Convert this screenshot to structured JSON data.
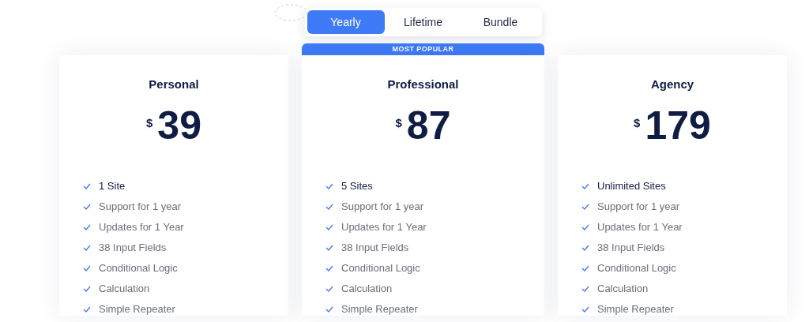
{
  "tabs": [
    {
      "label": "Yearly",
      "selected": true
    },
    {
      "label": "Lifetime",
      "selected": false
    },
    {
      "label": "Bundle",
      "selected": false
    }
  ],
  "plans": [
    {
      "name": "Personal",
      "currency": "$",
      "price": "39",
      "features": [
        {
          "text": "1 Site",
          "emphasis": true
        },
        {
          "text": "Support for 1 year",
          "emphasis": false
        },
        {
          "text": "Updates for 1 Year",
          "emphasis": false
        },
        {
          "text": "38 Input Fields",
          "emphasis": false
        },
        {
          "text": "Conditional Logic",
          "emphasis": false
        },
        {
          "text": "Calculation",
          "emphasis": false
        },
        {
          "text": "Simple Repeater",
          "emphasis": false
        }
      ]
    },
    {
      "name": "Professional",
      "currency": "$",
      "price": "87",
      "badge": "MOST POPULAR",
      "features": [
        {
          "text": "5 Sites",
          "emphasis": true
        },
        {
          "text": "Support for 1 year",
          "emphasis": false
        },
        {
          "text": "Updates for 1 Year",
          "emphasis": false
        },
        {
          "text": "38 Input Fields",
          "emphasis": false
        },
        {
          "text": "Conditional Logic",
          "emphasis": false
        },
        {
          "text": "Calculation",
          "emphasis": false
        },
        {
          "text": "Simple Repeater",
          "emphasis": false
        }
      ]
    },
    {
      "name": "Agency",
      "currency": "$",
      "price": "179",
      "features": [
        {
          "text": "Unlimited Sites",
          "emphasis": true
        },
        {
          "text": "Support for 1 year",
          "emphasis": false
        },
        {
          "text": "Updates for 1 Year",
          "emphasis": false
        },
        {
          "text": "38 Input Fields",
          "emphasis": false
        },
        {
          "text": "Conditional Logic",
          "emphasis": false
        },
        {
          "text": "Calculation",
          "emphasis": false
        },
        {
          "text": "Simple Repeater",
          "emphasis": false
        }
      ]
    }
  ]
}
